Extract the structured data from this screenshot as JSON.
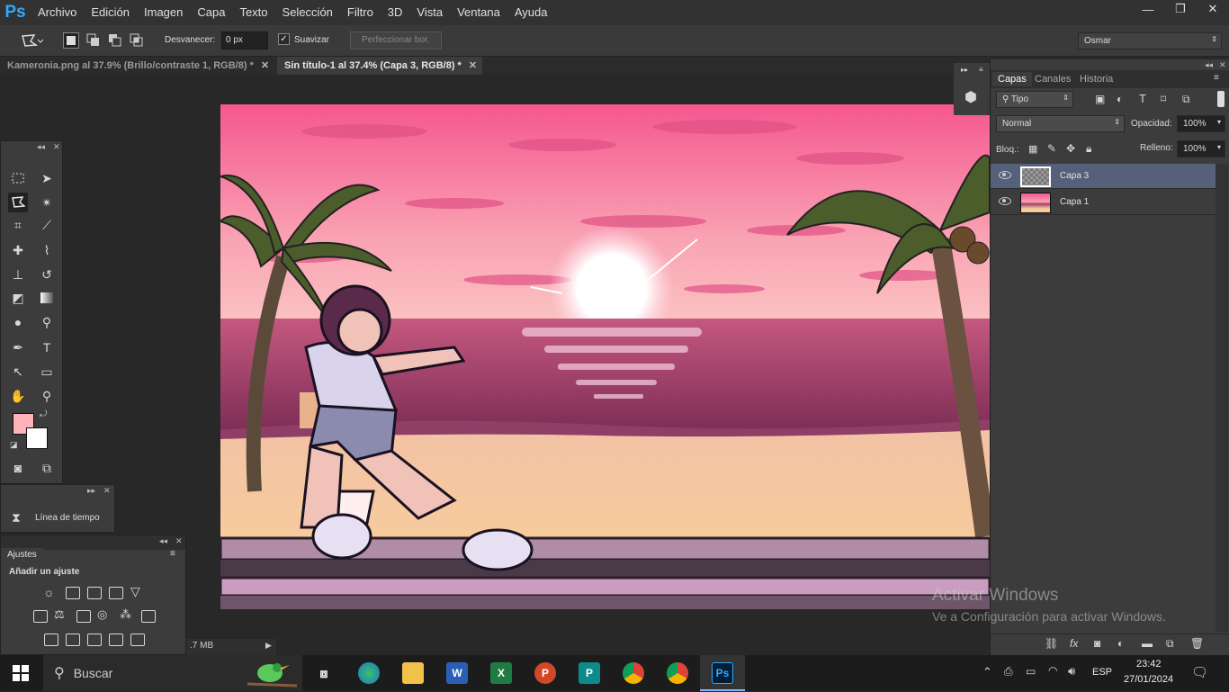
{
  "app": {
    "logo": "Ps"
  },
  "menu": [
    "Archivo",
    "Edición",
    "Imagen",
    "Capa",
    "Texto",
    "Selección",
    "Filtro",
    "3D",
    "Vista",
    "Ventana",
    "Ayuda"
  ],
  "window_controls": {
    "minimize": "—",
    "maximize": "❐",
    "close": "✕"
  },
  "options": {
    "feather_label": "Desvanecer:",
    "feather_value": "0 px",
    "smooth_label": "Suavizar",
    "refine_button": "Perfeccionar bor.",
    "workspace": "Osmar"
  },
  "tabs": [
    {
      "label": "Kameronia.png al 37.9% (Brillo/contraste 1, RGB/8) *",
      "active": false
    },
    {
      "label": "Sin título-1 al 37.4% (Capa 3, RGB/8) *",
      "active": true
    }
  ],
  "timeline": {
    "label": "Línea de tiempo"
  },
  "adjustments": {
    "tab": "Ajustes",
    "heading": "Añadir un ajuste"
  },
  "status": {
    "text": ".7 MB"
  },
  "layers_panel": {
    "tabs": [
      "Capas",
      "Canales",
      "Historia"
    ],
    "filter": "Tipo",
    "blend_mode": "Normal",
    "opacity_label": "Opacidad:",
    "opacity_value": "100%",
    "lock_label": "Bloq.:",
    "fill_label": "Relleno:",
    "fill_value": "100%",
    "layers": [
      {
        "name": "Capa 3",
        "selected": true
      },
      {
        "name": "Capa 1",
        "selected": false
      }
    ]
  },
  "watermark": {
    "title": "Activar Windows",
    "subtitle": "Ve a Configuración para activar Windows."
  },
  "taskbar": {
    "search_placeholder": "Buscar",
    "language": "ESP",
    "time": "23:42",
    "date": "27/01/2024"
  },
  "colors": {
    "foreground": "#ffb3b8",
    "background": "#ffffff",
    "accent": "#31a8ff"
  }
}
